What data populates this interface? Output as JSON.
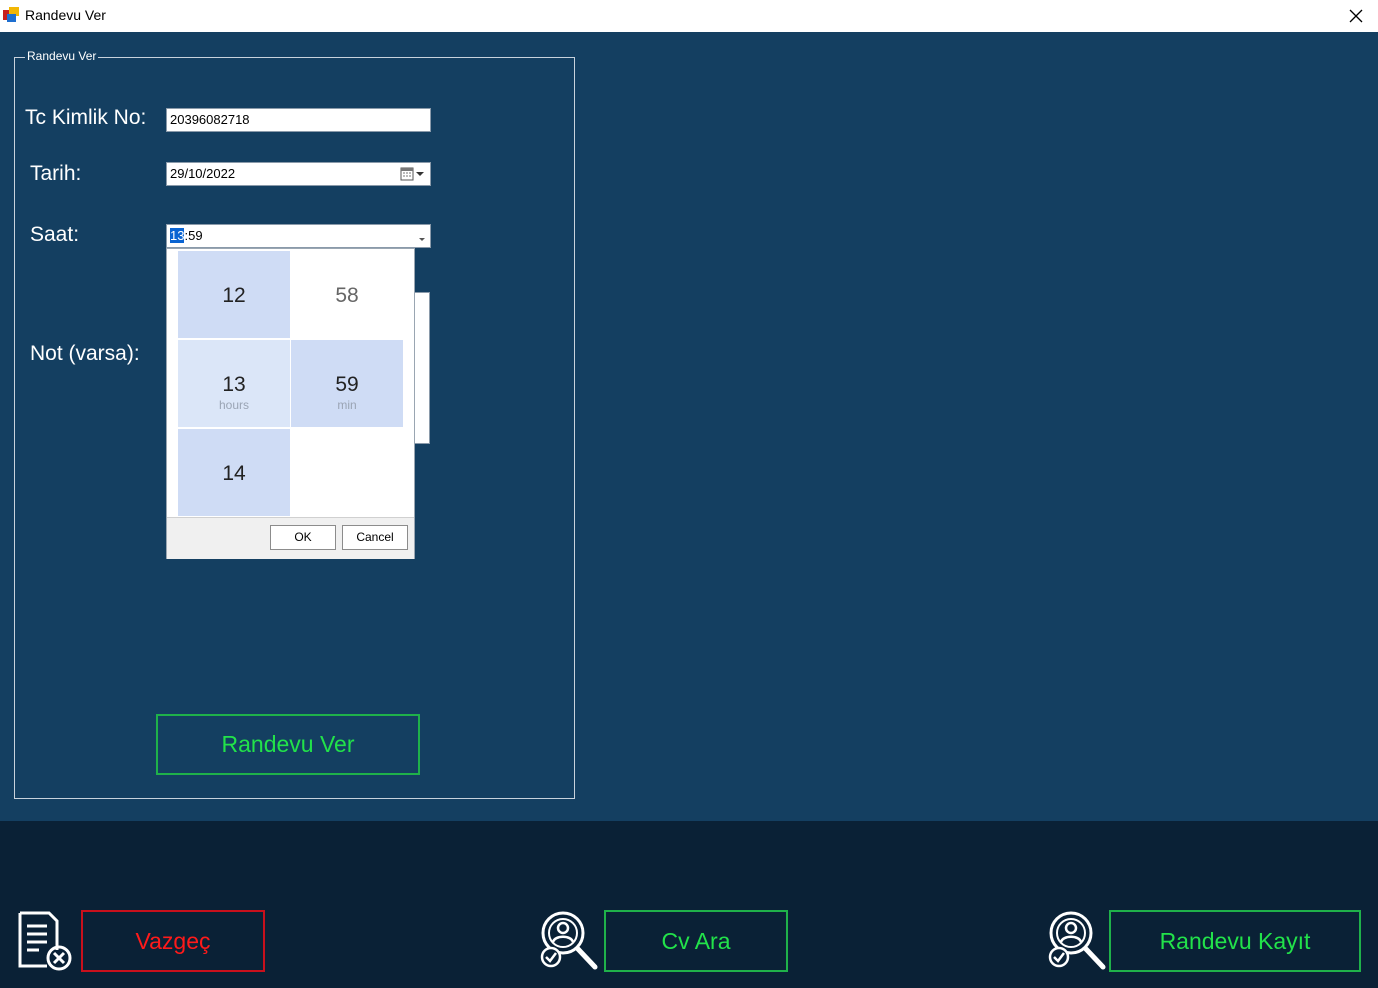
{
  "window": {
    "title": "Randevu Ver"
  },
  "group": {
    "legend": "Randevu Ver"
  },
  "form": {
    "tc_label": "Tc Kimlik No:",
    "tc_value": "20396082718",
    "tarih_label": "Tarih:",
    "tarih_value": "29/10/2022",
    "saat_label": "Saat:",
    "saat_hour": "13",
    "saat_sep": ":",
    "saat_min": "59",
    "not_label": "Not (varsa):"
  },
  "time_picker": {
    "hours": [
      "12",
      "13",
      "14"
    ],
    "minutes": [
      "58",
      "59"
    ],
    "hours_caption": "hours",
    "min_caption": "min",
    "ok_label": "OK",
    "cancel_label": "Cancel"
  },
  "buttons": {
    "randevu_ver": "Randevu Ver",
    "vazgec": "Vazgeç",
    "cv_ara": "Cv Ara",
    "randevu_kayit": "Randevu Kayıt"
  },
  "colors": {
    "panel_bg": "#143f61",
    "bottom_bg": "#0a2136",
    "accent_green": "#22e24a",
    "accent_red": "#ff1a1a",
    "picker_cell": "#cfdcf5",
    "picker_cell_light": "#dbe6f8"
  },
  "icons": [
    "app-icon",
    "close-icon",
    "calendar-icon",
    "chevron-down-icon",
    "document-cancel-icon",
    "user-search-icon"
  ]
}
